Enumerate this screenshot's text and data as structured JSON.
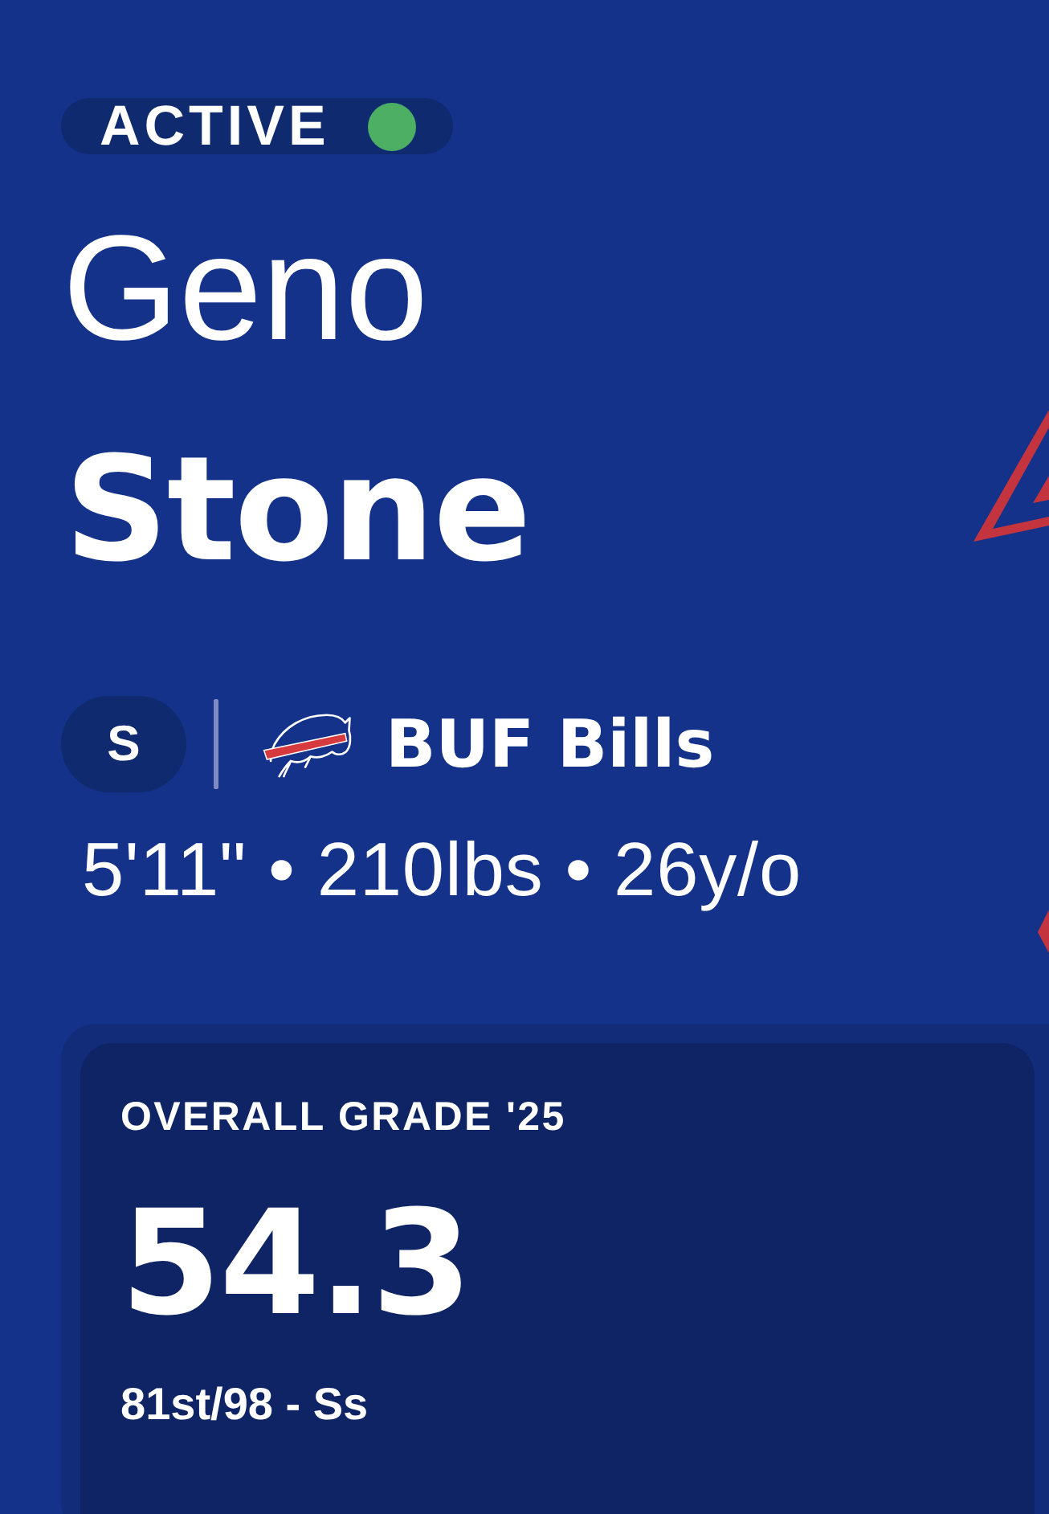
{
  "status": {
    "label": "ACTIVE",
    "active": true
  },
  "player": {
    "first_name": "Geno",
    "last_name": "Stone",
    "position": "S",
    "team": "BUF Bills",
    "measurements": "5'11\" • 210lbs • 26y/o"
  },
  "grade_card": {
    "title": "OVERALL GRADE '25",
    "grade": "54.3",
    "rank": "81st/98 - Ss"
  }
}
